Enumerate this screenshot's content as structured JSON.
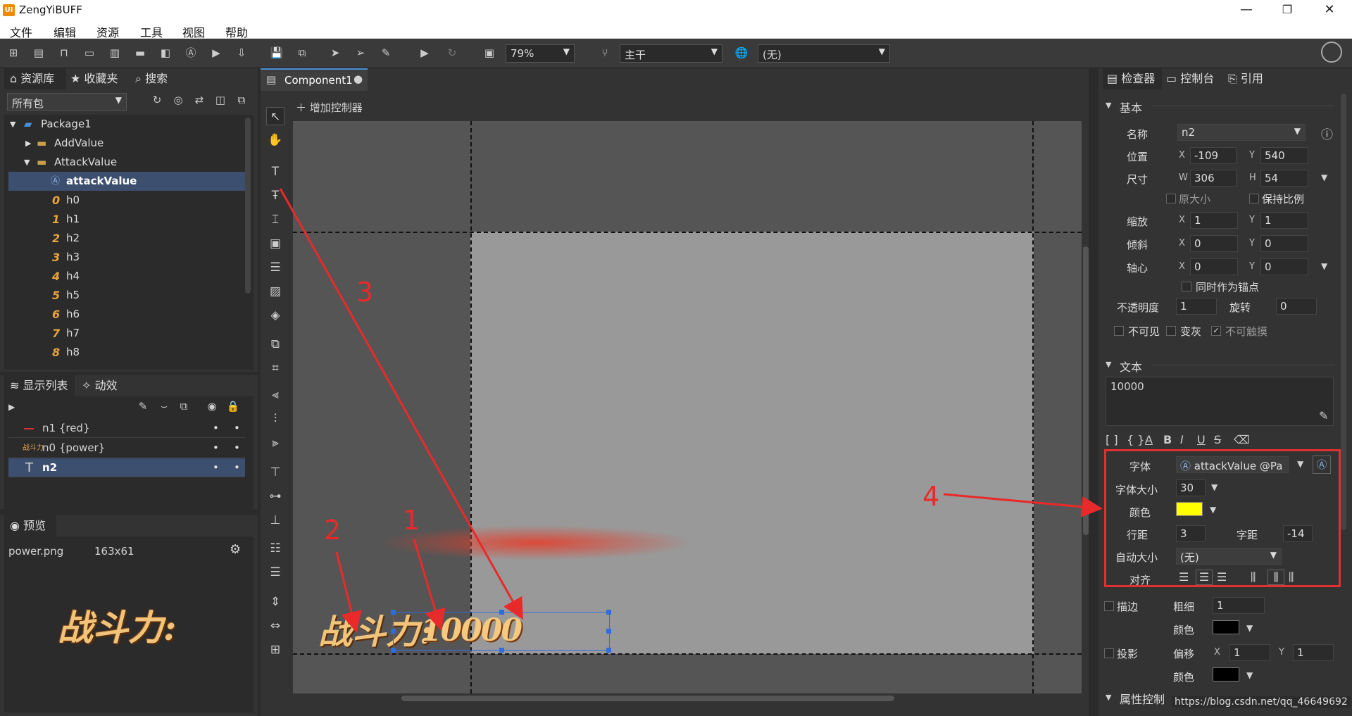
{
  "app": {
    "title": "ZengYiBUFF",
    "logo": "UI"
  },
  "menu": [
    "文件",
    "编辑",
    "资源",
    "工具",
    "视图",
    "帮助"
  ],
  "toolbar": {
    "zoom": "79%",
    "branch": "主干",
    "lang": "(无)"
  },
  "left": {
    "tabs": [
      "资源库",
      "收藏夹",
      "搜索"
    ],
    "package_filter": "所有包",
    "tree": [
      {
        "label": "Package1",
        "icon": "package-icon"
      },
      {
        "label": "AddValue",
        "icon": "folder-icon"
      },
      {
        "label": "AttackValue",
        "icon": "folder-icon"
      },
      {
        "label": "attackValue",
        "icon": "font-file-icon"
      },
      {
        "label": "h0",
        "glyph": "0"
      },
      {
        "label": "h1",
        "glyph": "1"
      },
      {
        "label": "h2",
        "glyph": "2"
      },
      {
        "label": "h3",
        "glyph": "3"
      },
      {
        "label": "h4",
        "glyph": "4"
      },
      {
        "label": "h5",
        "glyph": "5"
      },
      {
        "label": "h6",
        "glyph": "6"
      },
      {
        "label": "h7",
        "glyph": "7"
      },
      {
        "label": "h8",
        "glyph": "8"
      }
    ],
    "display_tabs": [
      "显示列表",
      "动效"
    ],
    "display_list": [
      {
        "label": "n1 {red}"
      },
      {
        "label": "n0 {power}"
      },
      {
        "label": "n2"
      }
    ],
    "preview_tab": "预览",
    "preview_file": "power.png",
    "preview_size": "163x61",
    "preview_art": "战斗力:"
  },
  "center": {
    "doc_tab": "Component1",
    "add_controller": "增加控制器",
    "canvas_art": "战斗力:",
    "canvas_value": "10000",
    "annotations": [
      "1",
      "2",
      "3",
      "4"
    ]
  },
  "right": {
    "tabs": [
      "检查器",
      "控制台",
      "引用"
    ],
    "basic": {
      "header": "基本",
      "name_label": "名称",
      "name": "n2",
      "pos_label": "位置",
      "x": "-109",
      "y": "540",
      "size_label": "尺寸",
      "w": "306",
      "h": "54",
      "orig_size": "原大小",
      "keep_ratio": "保持比例",
      "scale_label": "缩放",
      "sx": "1",
      "sy": "1",
      "skew_label": "倾斜",
      "kx": "0",
      "ky": "0",
      "pivot_label": "轴心",
      "px": "0",
      "py": "0",
      "as_anchor": "同时作为锚点",
      "opacity_label": "不透明度",
      "opacity": "1",
      "rotation_label": "旋转",
      "rotation": "0",
      "invisible": "不可见",
      "grayed": "变灰",
      "untouchable": "不可触摸"
    },
    "text": {
      "header": "文本",
      "content": "10000",
      "font_label": "字体",
      "font": "attackValue @Pa",
      "size_label": "字体大小",
      "size": "30",
      "color_label": "颜色",
      "color": "#ffff00",
      "line_label": "行距",
      "line": "3",
      "letter_label": "字距",
      "letter": "-14",
      "autosize_label": "自动大小",
      "autosize": "(无)",
      "align_label": "对齐"
    },
    "stroke": {
      "label": "描边",
      "thick_label": "粗细",
      "thick": "1",
      "color_label": "颜色",
      "color": "#000000"
    },
    "shadow": {
      "label": "投影",
      "offset_label": "偏移",
      "ox": "1",
      "oy": "1",
      "color_label": "颜色",
      "color": "#000000"
    },
    "prop_ctrl": "属性控制"
  },
  "watermark": "https://blog.csdn.net/qq_46649692"
}
